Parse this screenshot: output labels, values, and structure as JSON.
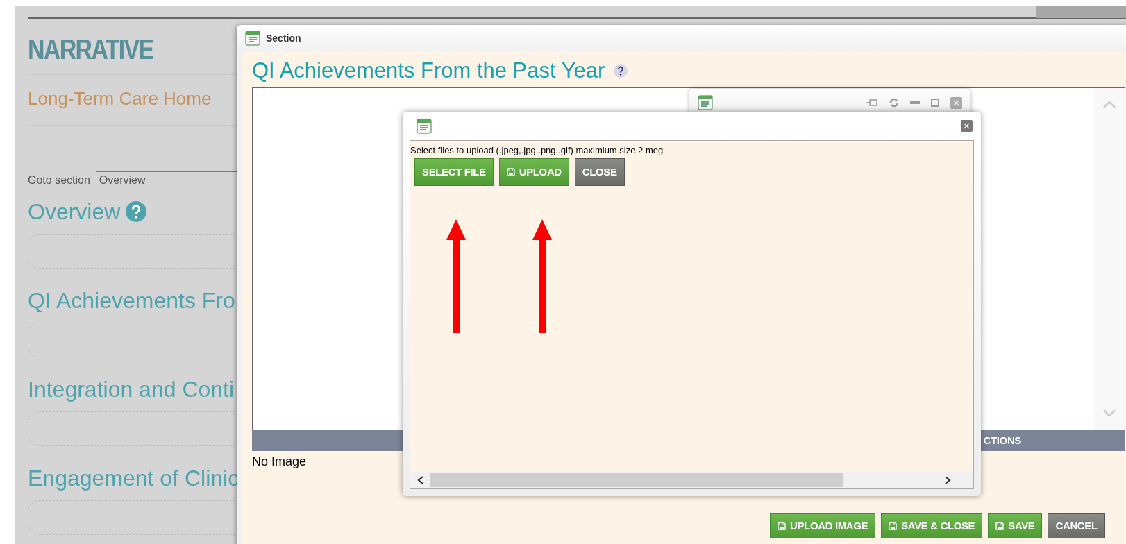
{
  "page": {
    "heading": "NARRATIVE",
    "subtitle": "Long-Term Care Home ",
    "goto_label": "Goto section",
    "goto_value": "Overview",
    "sections": [
      {
        "title": "Overview",
        "help": true
      },
      {
        "title": "QI Achievements Fro",
        "help": false
      },
      {
        "title": "Integration and Conti",
        "help": false
      },
      {
        "title": "Engagement of Clinic",
        "help": false
      }
    ]
  },
  "section_window": {
    "title": "Section",
    "heading": "QI Achievements From the Past Year",
    "table_header": "CTIONS",
    "row": "No Image",
    "buttons": [
      {
        "label": "UPLOAD IMAGE",
        "kind": "action",
        "icon": true
      },
      {
        "label": "SAVE & CLOSE",
        "kind": "action",
        "icon": true
      },
      {
        "label": "SAVE",
        "kind": "action",
        "icon": true
      },
      {
        "label": "CANCEL",
        "kind": "dismiss",
        "icon": false
      }
    ]
  },
  "upload_dialog": {
    "instruction": "Select files to upload (.jpeg,.jpg,.png,.gif) maximium size 2 meg",
    "buttons": [
      {
        "label": "SELECT FILE",
        "kind": "action",
        "icon": false
      },
      {
        "label": "UPLOAD",
        "kind": "action",
        "icon": true
      },
      {
        "label": "CLOSE",
        "kind": "dismiss",
        "icon": false
      }
    ]
  }
}
